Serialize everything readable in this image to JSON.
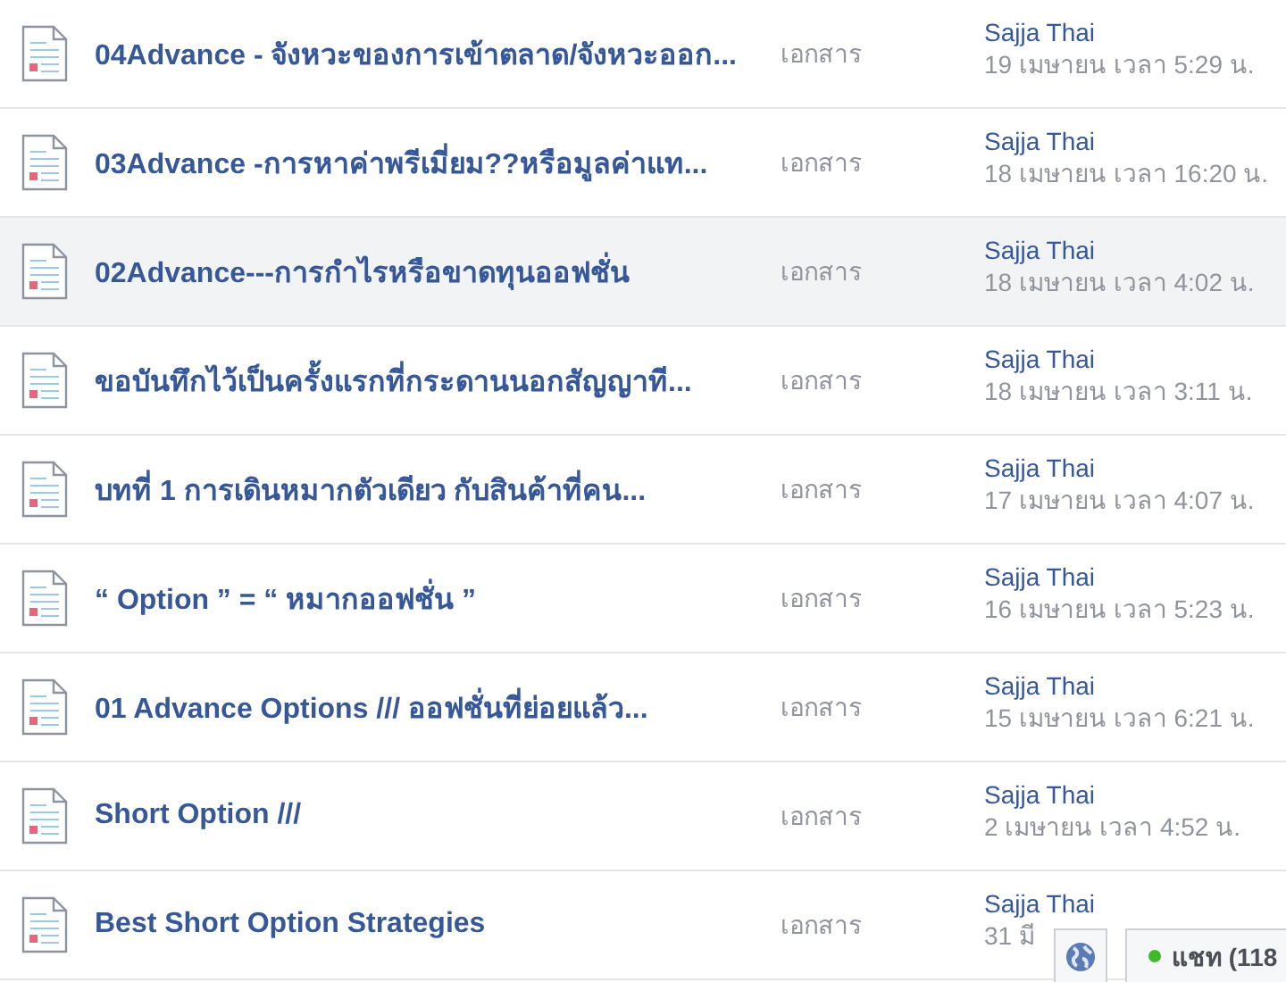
{
  "rows": [
    {
      "title": "04Advance - จังหวะของการเข้าตลาด/จังหวะออก...",
      "type": "เอกสาร",
      "author": "Sajja Thai",
      "date": "19 เมษายน เวลา 5:29 น.",
      "highlighted": false
    },
    {
      "title": "03Advance -การหาค่าพรีเมี่ยม??หรือมูลค่าแท...",
      "type": "เอกสาร",
      "author": "Sajja Thai",
      "date": "18 เมษายน เวลา 16:20 น.",
      "highlighted": false
    },
    {
      "title": "02Advance---การกำไรหรือขาดทุนออฟชั่น",
      "type": "เอกสาร",
      "author": "Sajja Thai",
      "date": "18 เมษายน เวลา 4:02 น.",
      "highlighted": true
    },
    {
      "title": "ขอบันทึกไว้เป็นครั้งแรกที่กระดานนอกสัญญาที...",
      "type": "เอกสาร",
      "author": "Sajja Thai",
      "date": "18 เมษายน เวลา 3:11 น.",
      "highlighted": false
    },
    {
      "title": "บทที่ 1 การเดินหมากตัวเดียว กับสินค้าที่คน...",
      "type": "เอกสาร",
      "author": "Sajja Thai",
      "date": "17 เมษายน เวลา 4:07 น.",
      "highlighted": false
    },
    {
      "title": "“ Option ” = “ หมากออฟชั่น ”",
      "type": "เอกสาร",
      "author": "Sajja Thai",
      "date": "16 เมษายน เวลา 5:23 น.",
      "highlighted": false
    },
    {
      "title": "01 Advance Options /// ออฟชั่นที่ย่อยแล้ว...",
      "type": "เอกสาร",
      "author": "Sajja Thai",
      "date": "15 เมษายน เวลา 6:21 น.",
      "highlighted": false
    },
    {
      "title": "Short Option ///",
      "type": "เอกสาร",
      "author": "Sajja Thai",
      "date": "2 เมษายน เวลา 4:52 น.",
      "highlighted": false
    },
    {
      "title": "Best Short Option Strategies",
      "type": "เอกสาร",
      "author": "Sajja Thai",
      "date": "31 มี",
      "highlighted": false
    }
  ],
  "chat_bar": {
    "label": "แชท (118",
    "online": true
  }
}
